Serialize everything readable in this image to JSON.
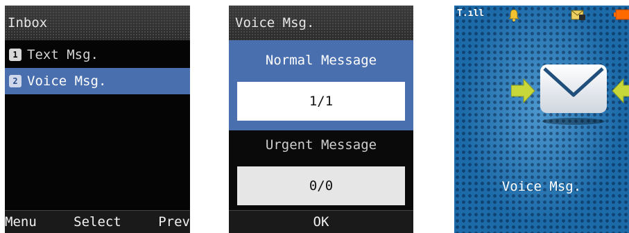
{
  "screen_inbox": {
    "title": "Inbox",
    "items": [
      {
        "number": "1",
        "label": "Text Msg.",
        "selected": false
      },
      {
        "number": "2",
        "label": "Voice Msg.",
        "selected": true
      }
    ],
    "softkeys": {
      "left": "Menu",
      "center": "Select",
      "right": "Prev"
    }
  },
  "screen_voice": {
    "title": "Voice Msg.",
    "normal_label": "Normal Message",
    "normal_value": "1/1",
    "urgent_label": "Urgent Message",
    "urgent_value": "0/0",
    "softkey_center": "OK"
  },
  "screen_notify": {
    "status_icons": [
      "signal-icon",
      "bell-icon",
      "message-icon",
      "battery-icon"
    ],
    "signal_text": "T.ıll",
    "caption": "Voice Msg."
  },
  "colors": {
    "selection": "#4a6faf",
    "notify_background": "#1c6aa8",
    "arrow": "#c8d83a"
  }
}
